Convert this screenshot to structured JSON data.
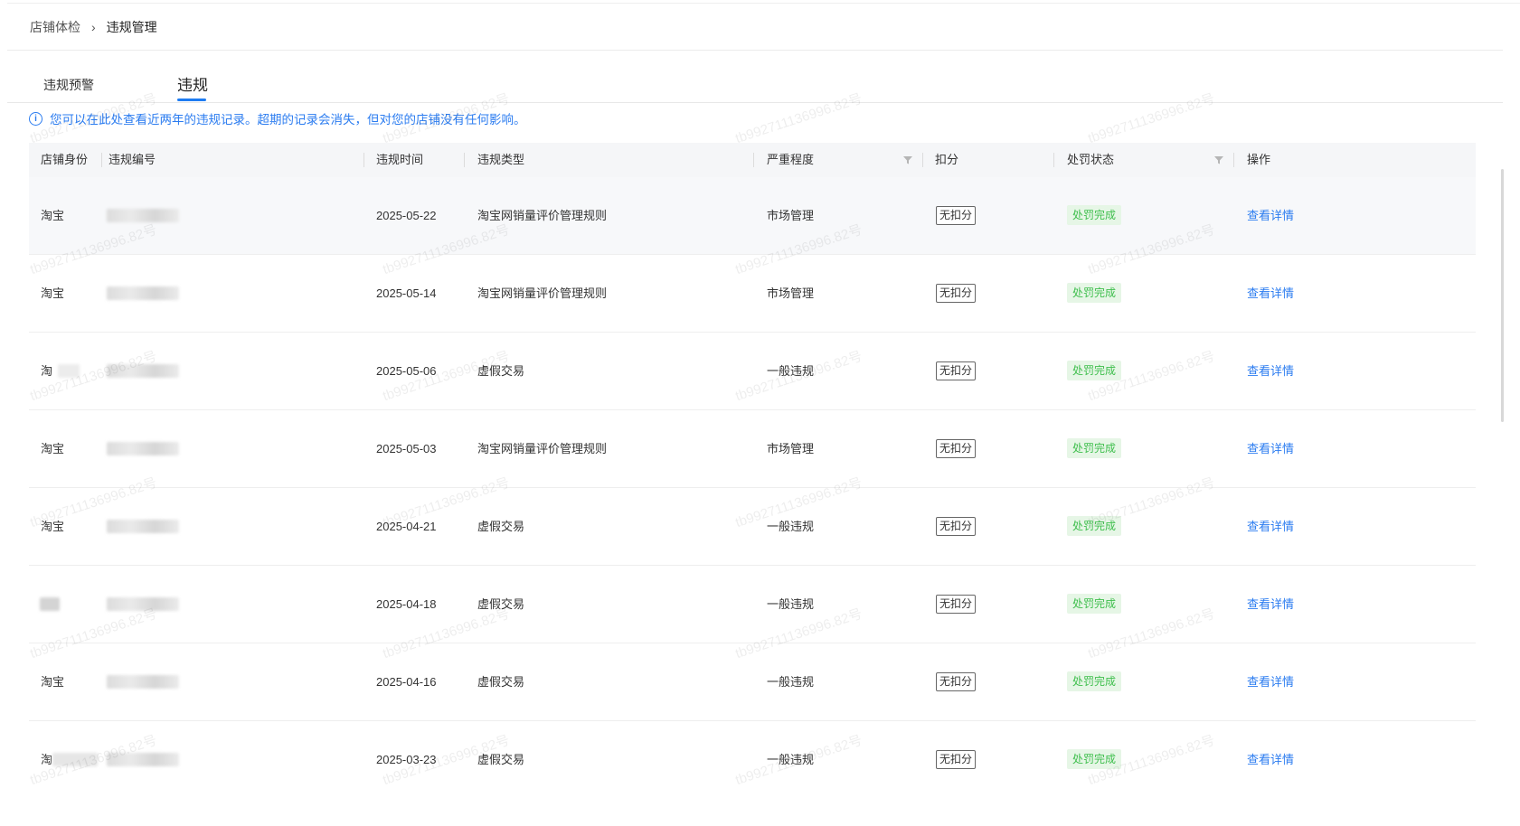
{
  "breadcrumb": {
    "parent": "店铺体检",
    "separator": "›",
    "current": "违规管理"
  },
  "tabs": [
    {
      "label": "违规预警",
      "active": false
    },
    {
      "label": "违规",
      "active": true
    }
  ],
  "notice": {
    "icon": "info-icon",
    "text": "您可以在此处查看近两年的违规记录。超期的记录会消失，但对您的店铺没有任何影响。"
  },
  "table": {
    "headers": {
      "identity": "店铺身份",
      "code": "违规编号",
      "time": "违规时间",
      "type": "违规类型",
      "severity": "严重程度",
      "score": "扣分",
      "status": "处罚状态",
      "action": "操作"
    },
    "rows": [
      {
        "identity": "淘宝",
        "time": "2025-05-22",
        "type": "淘宝网销量评价管理规则",
        "severity": "市场管理",
        "score": "无扣分",
        "status": "处罚完成",
        "action": "查看详情"
      },
      {
        "identity": "淘宝",
        "time": "2025-05-14",
        "type": "淘宝网销量评价管理规则",
        "severity": "市场管理",
        "score": "无扣分",
        "status": "处罚完成",
        "action": "查看详情"
      },
      {
        "identity": "淘",
        "time": "2025-05-06",
        "type": "虚假交易",
        "severity": "一般违规",
        "score": "无扣分",
        "status": "处罚完成",
        "action": "查看详情"
      },
      {
        "identity": "淘宝",
        "time": "2025-05-03",
        "type": "淘宝网销量评价管理规则",
        "severity": "市场管理",
        "score": "无扣分",
        "status": "处罚完成",
        "action": "查看详情"
      },
      {
        "identity": "淘宝",
        "time": "2025-04-21",
        "type": "虚假交易",
        "severity": "一般违规",
        "score": "无扣分",
        "status": "处罚完成",
        "action": "查看详情"
      },
      {
        "identity": "",
        "time": "2025-04-18",
        "type": "虚假交易",
        "severity": "一般违规",
        "score": "无扣分",
        "status": "处罚完成",
        "action": "查看详情"
      },
      {
        "identity": "淘宝",
        "time": "2025-04-16",
        "type": "虚假交易",
        "severity": "一般违规",
        "score": "无扣分",
        "status": "处罚完成",
        "action": "查看详情"
      },
      {
        "identity": "淘",
        "time": "2025-03-23",
        "type": "虚假交易",
        "severity": "一般违规",
        "score": "无扣分",
        "status": "处罚完成",
        "action": "查看详情"
      }
    ]
  },
  "watermark": "tb992711136996.82号",
  "colors": {
    "link": "#2b7cf0",
    "tab_ink": "#1e7cf2",
    "status_text": "#3fbf4d",
    "status_bg": "#e6f6e6",
    "header_bg": "#f5f6f8"
  }
}
